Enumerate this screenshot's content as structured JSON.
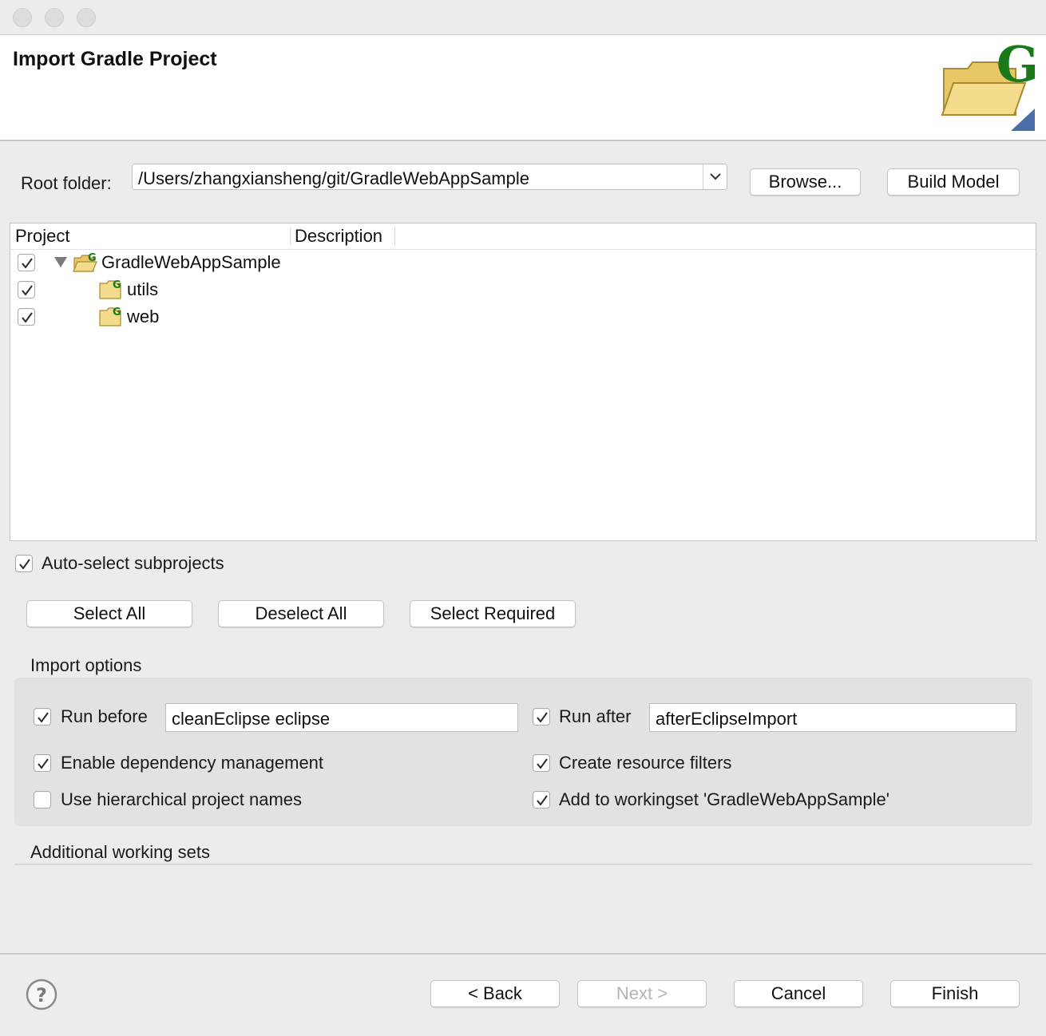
{
  "window": {
    "traffic_lights": [
      "close",
      "minimize",
      "zoom"
    ]
  },
  "header": {
    "title": "Import Gradle Project",
    "banner_icon": "gradle-folder-icon",
    "banner_letter": "G"
  },
  "root": {
    "label": "Root folder:",
    "value": "/Users/zhangxiansheng/git/GradleWebAppSample",
    "browse_label": "Browse...",
    "build_model_label": "Build Model"
  },
  "table": {
    "columns": [
      "Project",
      "Description"
    ],
    "rows": [
      {
        "name": "GradleWebAppSample",
        "checked": true,
        "expanded": true,
        "level": 0,
        "icon": "gradle-folder-open-icon"
      },
      {
        "name": "utils",
        "checked": true,
        "level": 1,
        "icon": "gradle-folder-icon"
      },
      {
        "name": "web",
        "checked": true,
        "level": 1,
        "icon": "gradle-folder-icon"
      }
    ]
  },
  "auto_select": {
    "label": "Auto-select subprojects",
    "checked": true
  },
  "selection_buttons": {
    "select_all": "Select All",
    "deselect_all": "Deselect All",
    "select_required": "Select Required"
  },
  "import_options": {
    "title": "Import options",
    "run_before": {
      "label": "Run before",
      "checked": true,
      "value": "cleanEclipse eclipse"
    },
    "run_after": {
      "label": "Run after",
      "checked": true,
      "value": "afterEclipseImport"
    },
    "enable_dep": {
      "label": "Enable dependency management",
      "checked": true
    },
    "resource_filters": {
      "label": "Create resource filters",
      "checked": true
    },
    "hierarchical": {
      "label": "Use hierarchical project names",
      "checked": false
    },
    "workingset": {
      "label": "Add to workingset 'GradleWebAppSample'",
      "checked": true
    }
  },
  "additional": {
    "title": "Additional working sets"
  },
  "footer": {
    "help_icon": "question-mark-icon",
    "back": "< Back",
    "next": "Next >",
    "cancel": "Cancel",
    "finish": "Finish"
  },
  "colors": {
    "gradle_green": "#1a7a1a",
    "folder_yellow": "#f2d27a"
  }
}
